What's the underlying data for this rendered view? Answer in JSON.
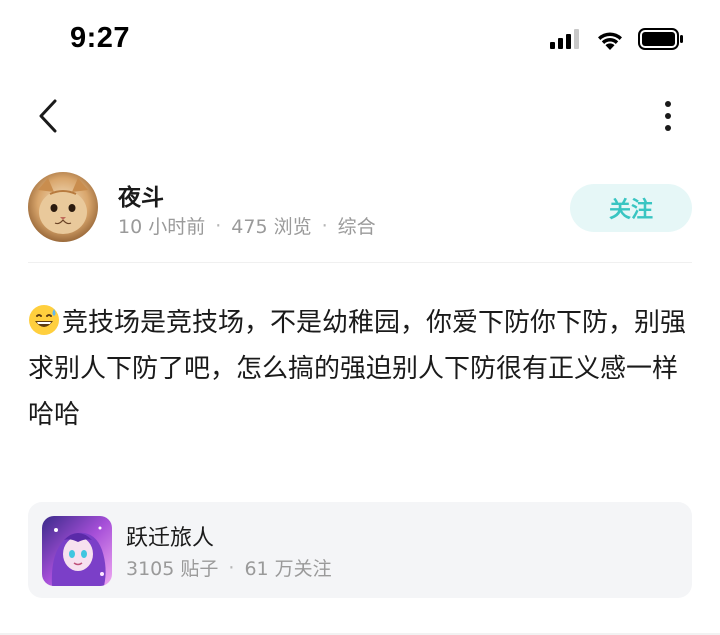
{
  "status_bar": {
    "time": "9:27",
    "icons": [
      "cellular-signal-icon",
      "wifi-icon",
      "battery-icon"
    ]
  },
  "nav": {
    "back_icon": "chevron-left-icon",
    "more_icon": "more-vertical-icon"
  },
  "author": {
    "name": "夜斗",
    "time_ago": "10 小时前",
    "views": "475 浏览",
    "category": "综合",
    "follow_label": "关注"
  },
  "post": {
    "emoji": "grinning-sweat-emoji",
    "text": "竞技场是竞技场，不是幼稚园，你爱下防你下防，别强求别人下防了吧，怎么搞的强迫别人下防很有正义感一样哈哈"
  },
  "forum": {
    "name": "跃迁旅人",
    "posts": "3105 贴子",
    "followers": "61 万关注"
  },
  "colors": {
    "accent": "#39c5c2",
    "follow_bg": "#e6f7f7",
    "meta_text": "#9a9a9a",
    "card_bg": "#f4f5f7"
  }
}
